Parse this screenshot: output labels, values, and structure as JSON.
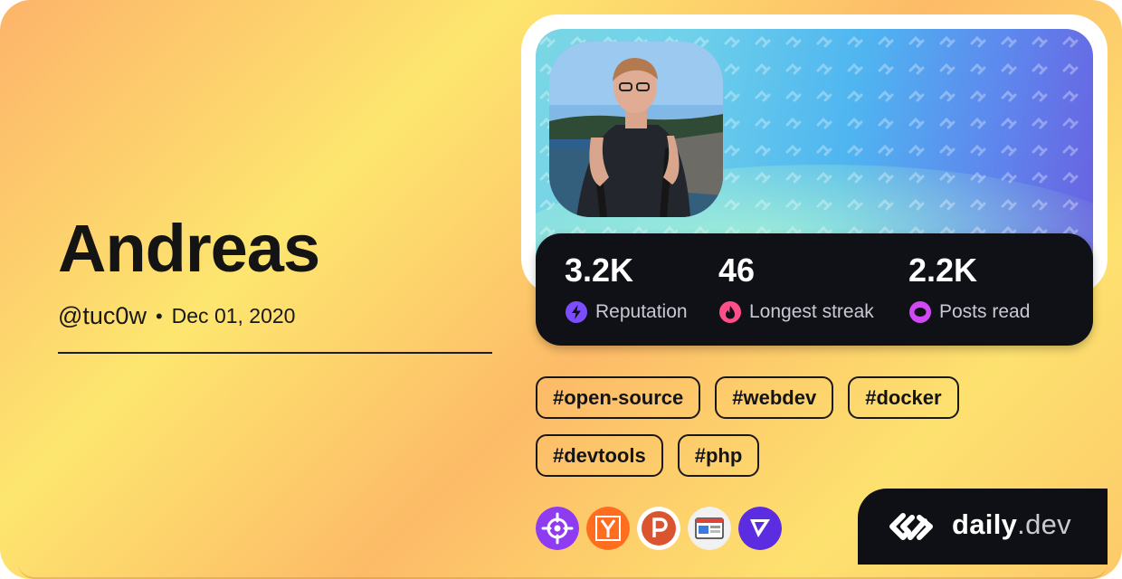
{
  "profile": {
    "name": "Andreas",
    "handle": "@tuc0w",
    "separator": "•",
    "joined": "Dec 01, 2020"
  },
  "stats": [
    {
      "value": "3.2K",
      "label": "Reputation",
      "icon": "lightning-icon",
      "color": "#7c4dff"
    },
    {
      "value": "46",
      "label": "Longest streak",
      "icon": "flame-icon",
      "color": "#ff4f8b"
    },
    {
      "value": "2.2K",
      "label": "Posts read",
      "icon": "reading-ring-icon",
      "color": "#d049f5"
    }
  ],
  "tags": [
    "#open-source",
    "#webdev",
    "#docker",
    "#devtools",
    "#php"
  ],
  "sources": [
    {
      "name": "crosshair-source-icon",
      "color": "#8e3bf2"
    },
    {
      "name": "y-source-icon",
      "color": "#ff6e1f"
    },
    {
      "name": "p-source-icon",
      "color": "#da552f"
    },
    {
      "name": "browser-source-icon",
      "color": "#e8e8e8"
    },
    {
      "name": "v-source-icon",
      "color": "#5b2ce0"
    }
  ],
  "brand": {
    "name": "daily",
    "suffix": ".dev"
  }
}
